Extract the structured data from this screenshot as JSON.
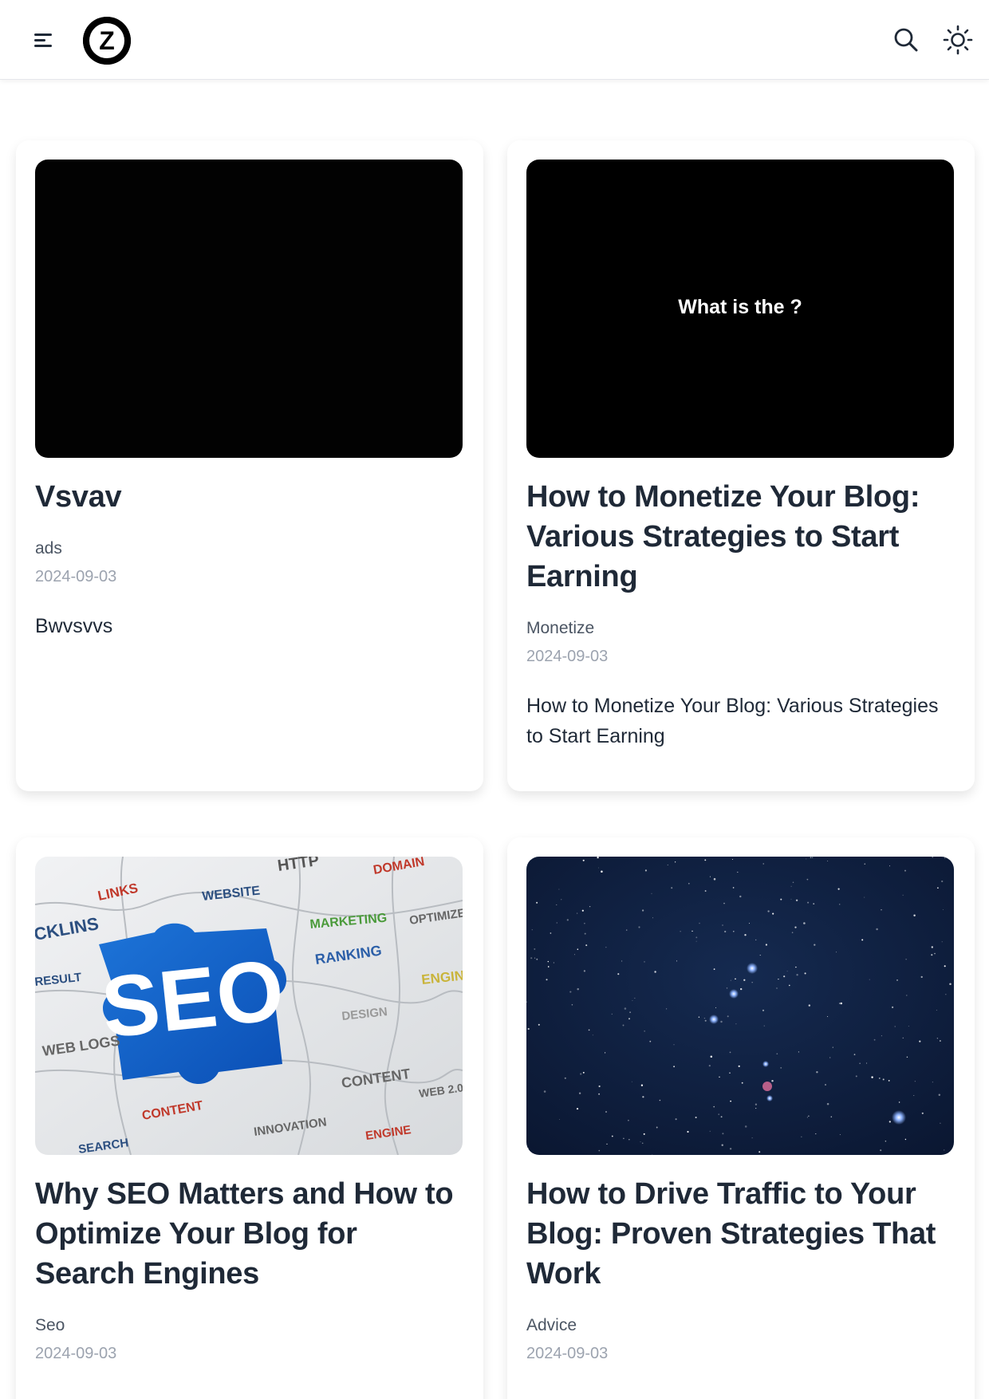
{
  "header": {
    "menu_icon": "menu-icon",
    "logo_letter": "Z",
    "search_icon": "search-icon",
    "theme_icon": "sun-icon"
  },
  "posts": [
    {
      "title": "Vsvav",
      "category": "ads",
      "date": "2024-09-03",
      "excerpt": "Bwvsvvs",
      "thumbnail": "black-image"
    },
    {
      "title": "How to Monetize Your Blog: Various Strategies to Start Earning",
      "category": "Monetize",
      "date": "2024-09-03",
      "excerpt": "How to Monetize Your Blog: Various Strategies to Start Earning",
      "thumbnail_text": "What is the ?"
    },
    {
      "title": "Why SEO Matters and How to Optimize Your Blog for Search Engines",
      "category": "Seo",
      "date": "2024-09-03",
      "thumbnail": "seo-puzzle-image",
      "thumbnail_words": [
        "SEO",
        "LINKS",
        "WEBSITE",
        "HTTP",
        "DOMAIN",
        "CKLINS",
        "MARKETING",
        "OPTIMIZE",
        "RANKING",
        "RESULT",
        "ENGINE",
        "DESIGN",
        "WEB LOGS",
        "CONTENT",
        "WEB 2.0",
        "CONTENT",
        "INNOVATION",
        "ENGINE",
        "SEARCH"
      ]
    },
    {
      "title": "How to Drive Traffic to Your Blog: Proven Strategies That Work",
      "category": "Advice",
      "date": "2024-09-03",
      "thumbnail": "night-sky-image"
    }
  ]
}
